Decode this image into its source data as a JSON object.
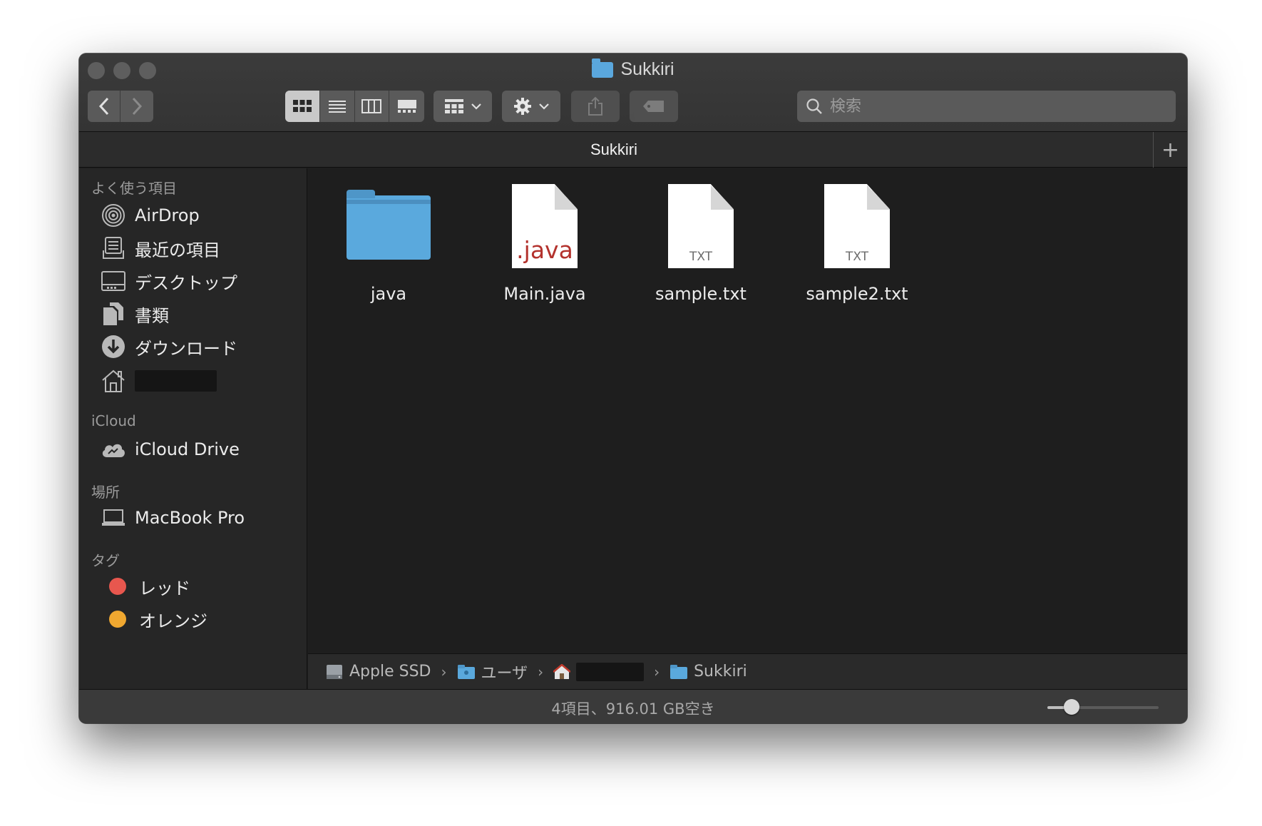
{
  "window": {
    "title": "Sukkiri"
  },
  "toolbar": {
    "back_label": "‹",
    "forward_label": "›",
    "search_placeholder": "検索"
  },
  "tabbar": {
    "title": "Sukkiri",
    "add_label": "+"
  },
  "sidebar": {
    "sections": [
      {
        "title": "よく使う項目",
        "items": [
          {
            "label": "AirDrop",
            "icon": "airdrop-icon"
          },
          {
            "label": "最近の項目",
            "icon": "recents-icon"
          },
          {
            "label": "デスクトップ",
            "icon": "desktop-icon"
          },
          {
            "label": "書類",
            "icon": "documents-icon"
          },
          {
            "label": "ダウンロード",
            "icon": "downloads-icon"
          },
          {
            "label": "",
            "icon": "home-icon",
            "redacted": true
          }
        ]
      },
      {
        "title": "iCloud",
        "items": [
          {
            "label": "iCloud Drive",
            "icon": "icloud-icon"
          }
        ]
      },
      {
        "title": "場所",
        "items": [
          {
            "label": "MacBook Pro",
            "icon": "laptop-icon"
          }
        ]
      },
      {
        "title": "タグ",
        "items": [
          {
            "label": "レッド",
            "color": "#e8574e"
          },
          {
            "label": "オレンジ",
            "color": "#f0a830"
          }
        ]
      }
    ]
  },
  "files": [
    {
      "name": "java",
      "kind": "folder"
    },
    {
      "name": "Main.java",
      "kind": "java",
      "badge": ".java"
    },
    {
      "name": "sample.txt",
      "kind": "txt",
      "badge": "TXT"
    },
    {
      "name": "sample2.txt",
      "kind": "txt",
      "badge": "TXT"
    }
  ],
  "pathbar": [
    {
      "label": "Apple SSD",
      "icon": "disk-icon"
    },
    {
      "label": "ユーザ",
      "icon": "folder-icon"
    },
    {
      "label": "",
      "icon": "home-icon",
      "redacted": true
    },
    {
      "label": "Sukkiri",
      "icon": "folder-icon"
    }
  ],
  "status": {
    "text": "4項目、916.01 GB空き",
    "zoom_fraction": 0.22
  },
  "colors": {
    "folder": "#5aa9dd",
    "java_text": "#b3322d",
    "tag_red": "#e8574e",
    "tag_orange": "#f0a830"
  }
}
